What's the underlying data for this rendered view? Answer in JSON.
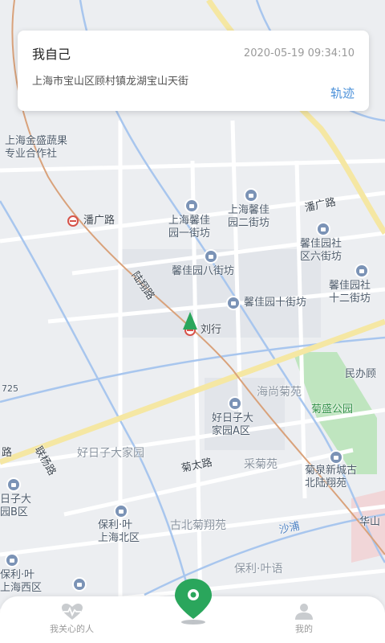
{
  "card": {
    "name": "我自己",
    "time": "2020-05-19 09:34:10",
    "address": "上海市宝山区顾村镇龙湖宝山天街",
    "track_label": "轨迹"
  },
  "map": {
    "labels": {
      "jinsheng": "上海金盛蔬果\n专业合作社",
      "panguang_station": "潘广路",
      "xinjia_1": "上海馨佳\n园一街坊",
      "xinjia_2": "上海馨佳\n园二街坊",
      "panguang_road": "潘广路",
      "xinjia_6": "馨佳园社\n区六街坊",
      "xinjia_8": "馨佳园八街坊",
      "luxiang_road": "陆翔路",
      "xinjia_10": "馨佳园十街坊",
      "xinjia_12": "馨佳园社\n十二街坊",
      "liuhang": "刘行",
      "minban": "民办顾",
      "road_725": "725",
      "haishang": "海尚菊苑",
      "jusheng": "菊盛公园",
      "haorizi_a": "好日子大\n家园A区",
      "haorizi": "好日子大家园",
      "lu_left": "路",
      "lianyang": "联杨路",
      "jutai": "菊太路",
      "caiju": "采菊苑",
      "juquan": "菊泉新城古\n北陆翔苑",
      "haorizi_b": "日子大\n园B区",
      "baoli_north": "保利·叶\n上海北区",
      "gubei": "古北菊翔苑",
      "shapu": "沙浦",
      "huashan": "华山",
      "baoli_west": "保利·叶\n上海西区",
      "baoli_yeyu": "保利·叶语"
    }
  },
  "tabbar": {
    "care_label": "我关心的人",
    "mine_label": "我的"
  },
  "colors": {
    "accent": "#4a90d9",
    "marker_green": "#2aa65c"
  }
}
